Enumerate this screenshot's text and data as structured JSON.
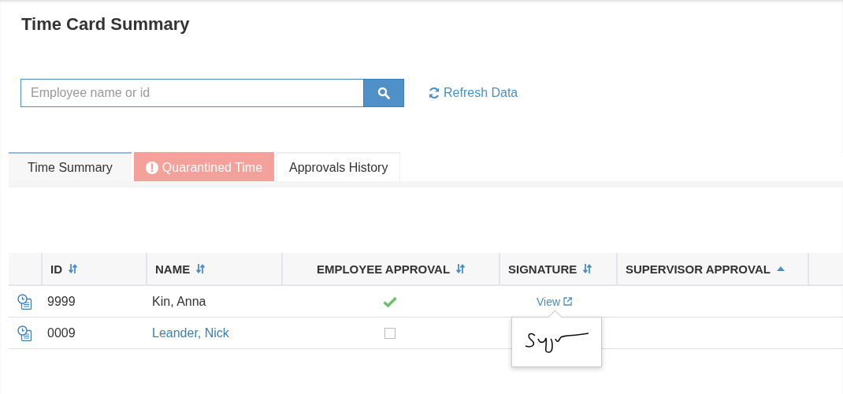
{
  "title": "Time Card Summary",
  "search": {
    "placeholder": "Employee name or id"
  },
  "refresh": {
    "label": "Refresh Data"
  },
  "tabs": [
    {
      "label": "Time Summary",
      "selected": true,
      "kind": "plain"
    },
    {
      "label": "Quarantined Time",
      "selected": false,
      "kind": "alert"
    },
    {
      "label": "Approvals History",
      "selected": false,
      "kind": "plain"
    }
  ],
  "table": {
    "columns": [
      {
        "label": "ID",
        "kind": "sortable",
        "centered": false
      },
      {
        "label": "NAME",
        "kind": "sortable",
        "centered": false
      },
      {
        "label": "EMPLOYEE APPROVAL",
        "kind": "sortable",
        "centered": true
      },
      {
        "label": "SIGNATURE",
        "kind": "sortable",
        "centered": false
      },
      {
        "label": "SUPERVISOR APPROVAL",
        "kind": "ascending",
        "centered": false
      }
    ],
    "rows": [
      {
        "id": "9999",
        "name": "Kin, Anna",
        "name_link": false,
        "employee_approval": true,
        "signature": {
          "label": "View",
          "popover_open": true
        }
      },
      {
        "id": "0009",
        "name": "Leander, Nick",
        "name_link": true,
        "employee_approval": false
      }
    ]
  }
}
